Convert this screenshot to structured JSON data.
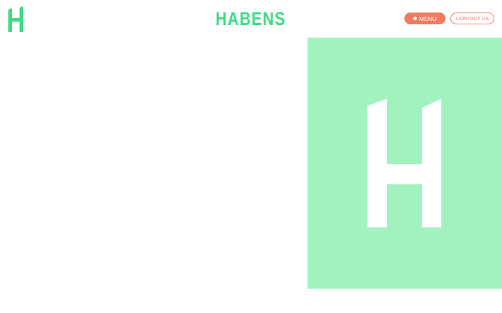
{
  "brand": {
    "name": "HABENS",
    "logo_icon": "habens-h-logo-icon"
  },
  "nav": {
    "menu_label": "MENU",
    "menu_dot_icon": "dot-icon",
    "contact_label": "CONTACT US"
  },
  "colors": {
    "brand_green": "#3ddc84",
    "accent_coral": "#f07b5f",
    "hero_panel_bg": "#a1f2bf",
    "hero_logo_fill": "#ffffff",
    "background": "#ffffff"
  }
}
